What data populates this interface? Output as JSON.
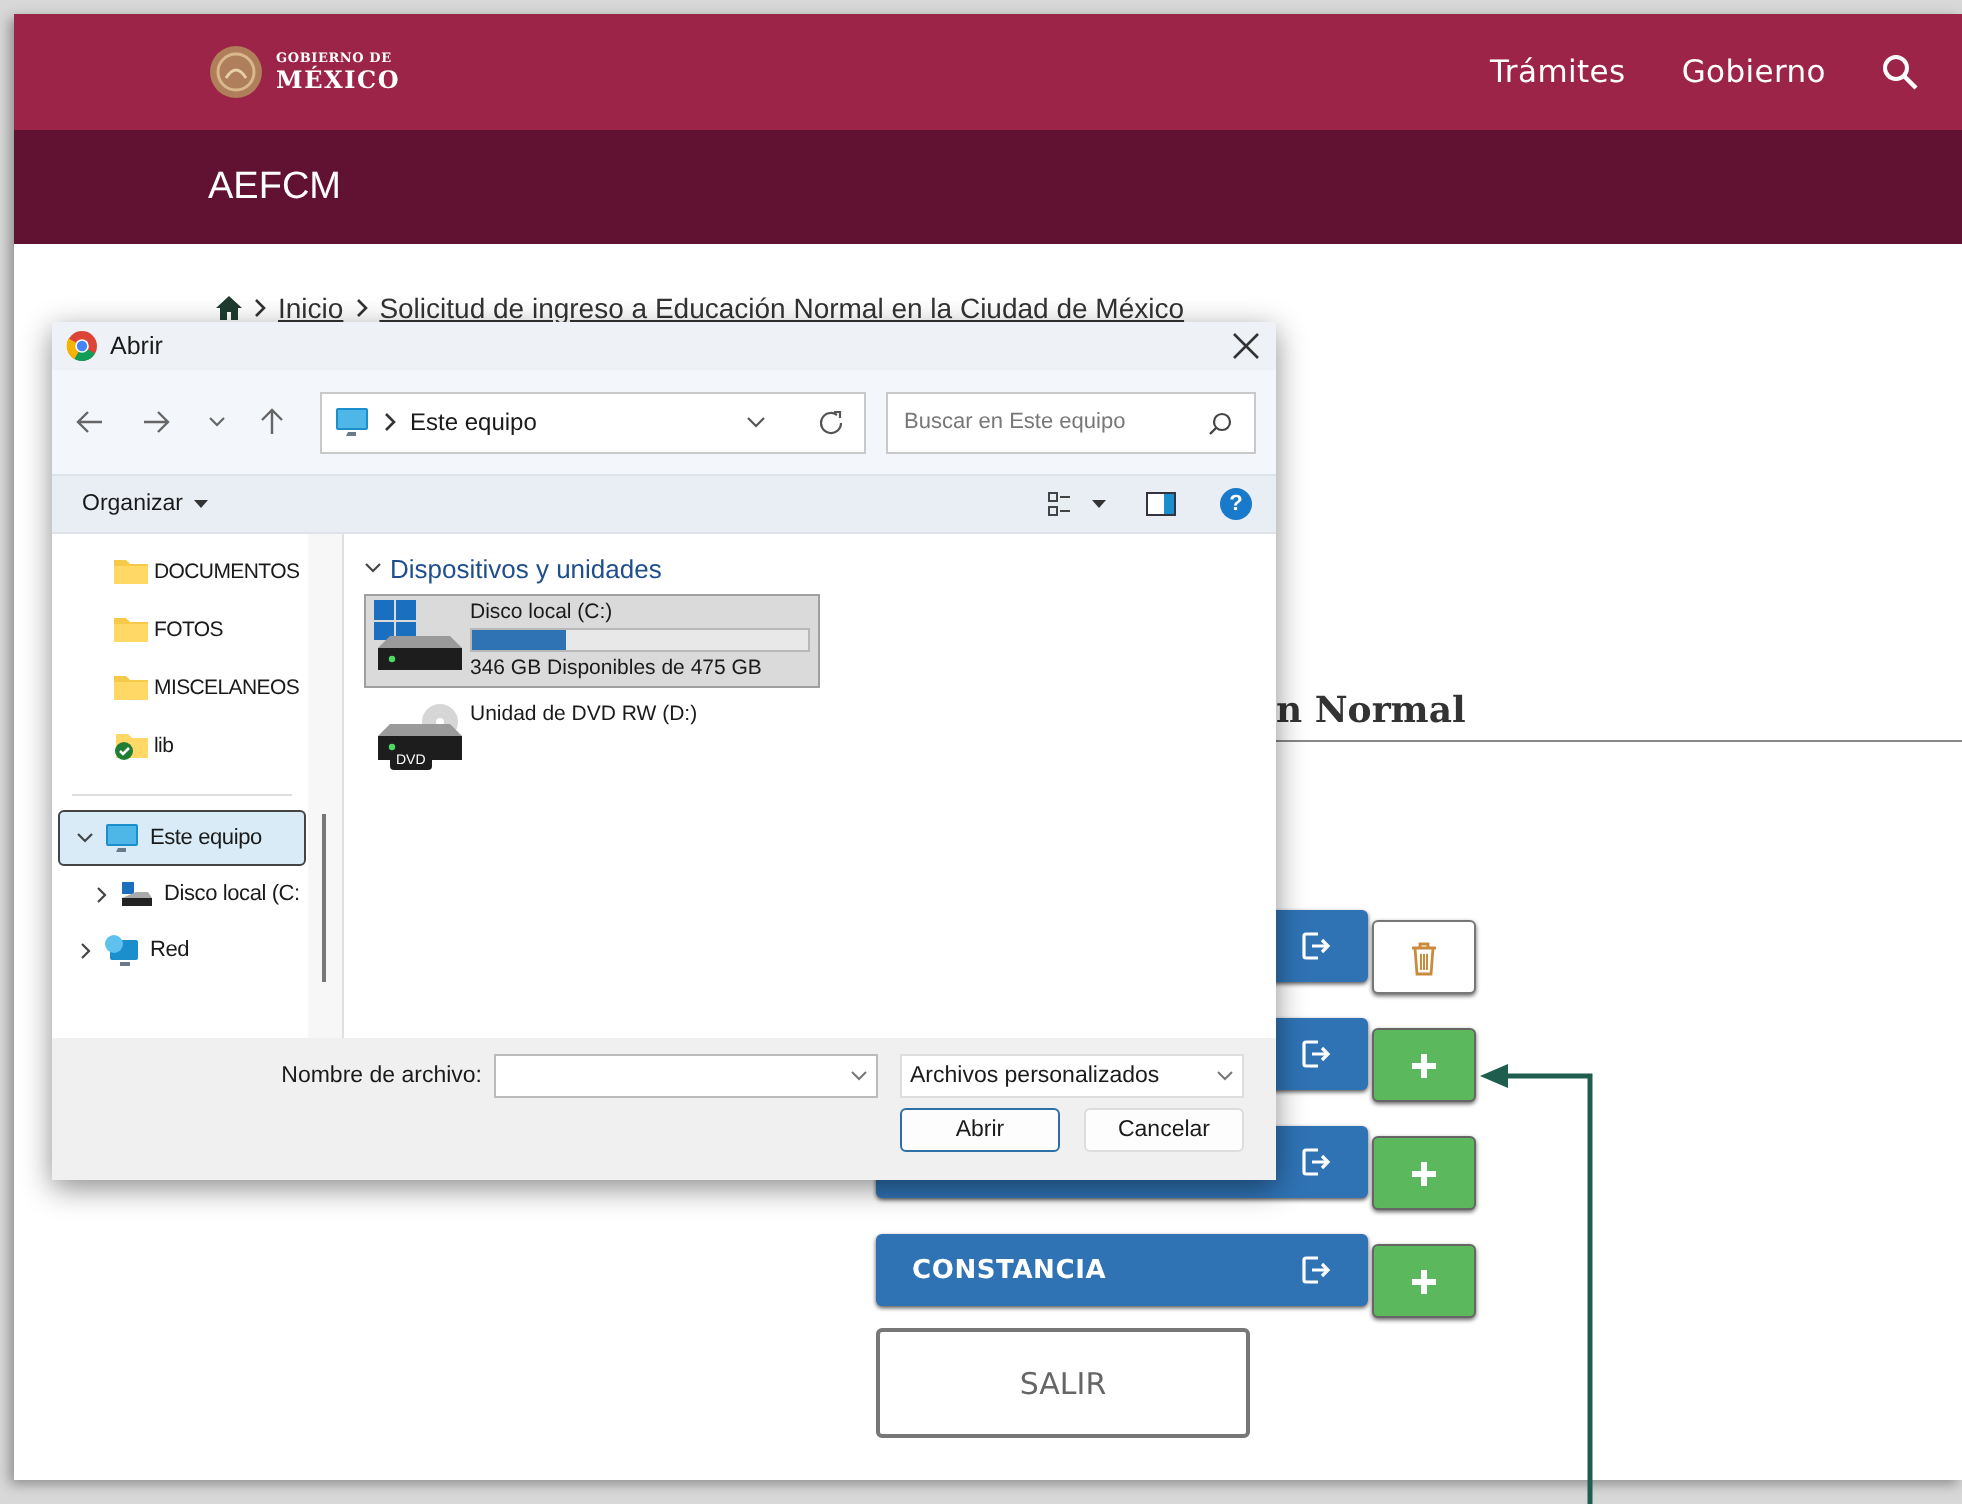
{
  "header": {
    "logo_small": "GOBIERNO DE",
    "logo_big": "MÉXICO",
    "nav": [
      "Trámites",
      "Gobierno"
    ]
  },
  "subheader": {
    "title": "AEFCM"
  },
  "breadcrumb": [
    "Inicio",
    "Solicitud de ingreso a Educación Normal en la Ciudad de México"
  ],
  "section": {
    "heading": "n Normal"
  },
  "documents": [
    {
      "kind": "delete"
    },
    {
      "kind": "add"
    },
    {
      "kind": "add"
    },
    {
      "label": "CONSTANCIA",
      "kind": "add"
    }
  ],
  "exit_button": "SALIR",
  "dialog": {
    "title": "Abrir",
    "address": "Este equipo",
    "search_placeholder": "Buscar en Este equipo",
    "organize": "Organizar",
    "help": "?",
    "quick_access": [
      {
        "label": "DOCUMENTOS",
        "kind": "folder"
      },
      {
        "label": "FOTOS",
        "kind": "folder"
      },
      {
        "label": "MISCELANEOS",
        "kind": "folder"
      },
      {
        "label": "lib",
        "kind": "synced"
      }
    ],
    "tree": [
      {
        "label": "Este equipo",
        "kind": "computer",
        "expanded": true,
        "selected": true,
        "children": [
          {
            "label": "Disco local (C:",
            "kind": "drive",
            "expanded": false,
            "selected": false
          }
        ]
      },
      {
        "label": "Red",
        "kind": "network",
        "expanded": false,
        "selected": false
      }
    ],
    "group": {
      "label": "Dispositivos y unidades",
      "expanded": true
    },
    "drives": [
      {
        "name": "Disco local (C:)",
        "kind": "hdd",
        "level": 0.28,
        "space": "346 GB Disponibles de 475 GB",
        "selected": true
      },
      {
        "name": "Unidad de DVD RW (D:)",
        "kind": "dvd",
        "badge": "DVD",
        "selected": false
      }
    ],
    "filename_label": "Nombre de archivo:",
    "file_type": "Archivos personalizados",
    "buttons": [
      {
        "label": "Abrir",
        "kind": "primary"
      },
      {
        "label": "Cancelar",
        "kind": "secondary"
      }
    ]
  }
}
